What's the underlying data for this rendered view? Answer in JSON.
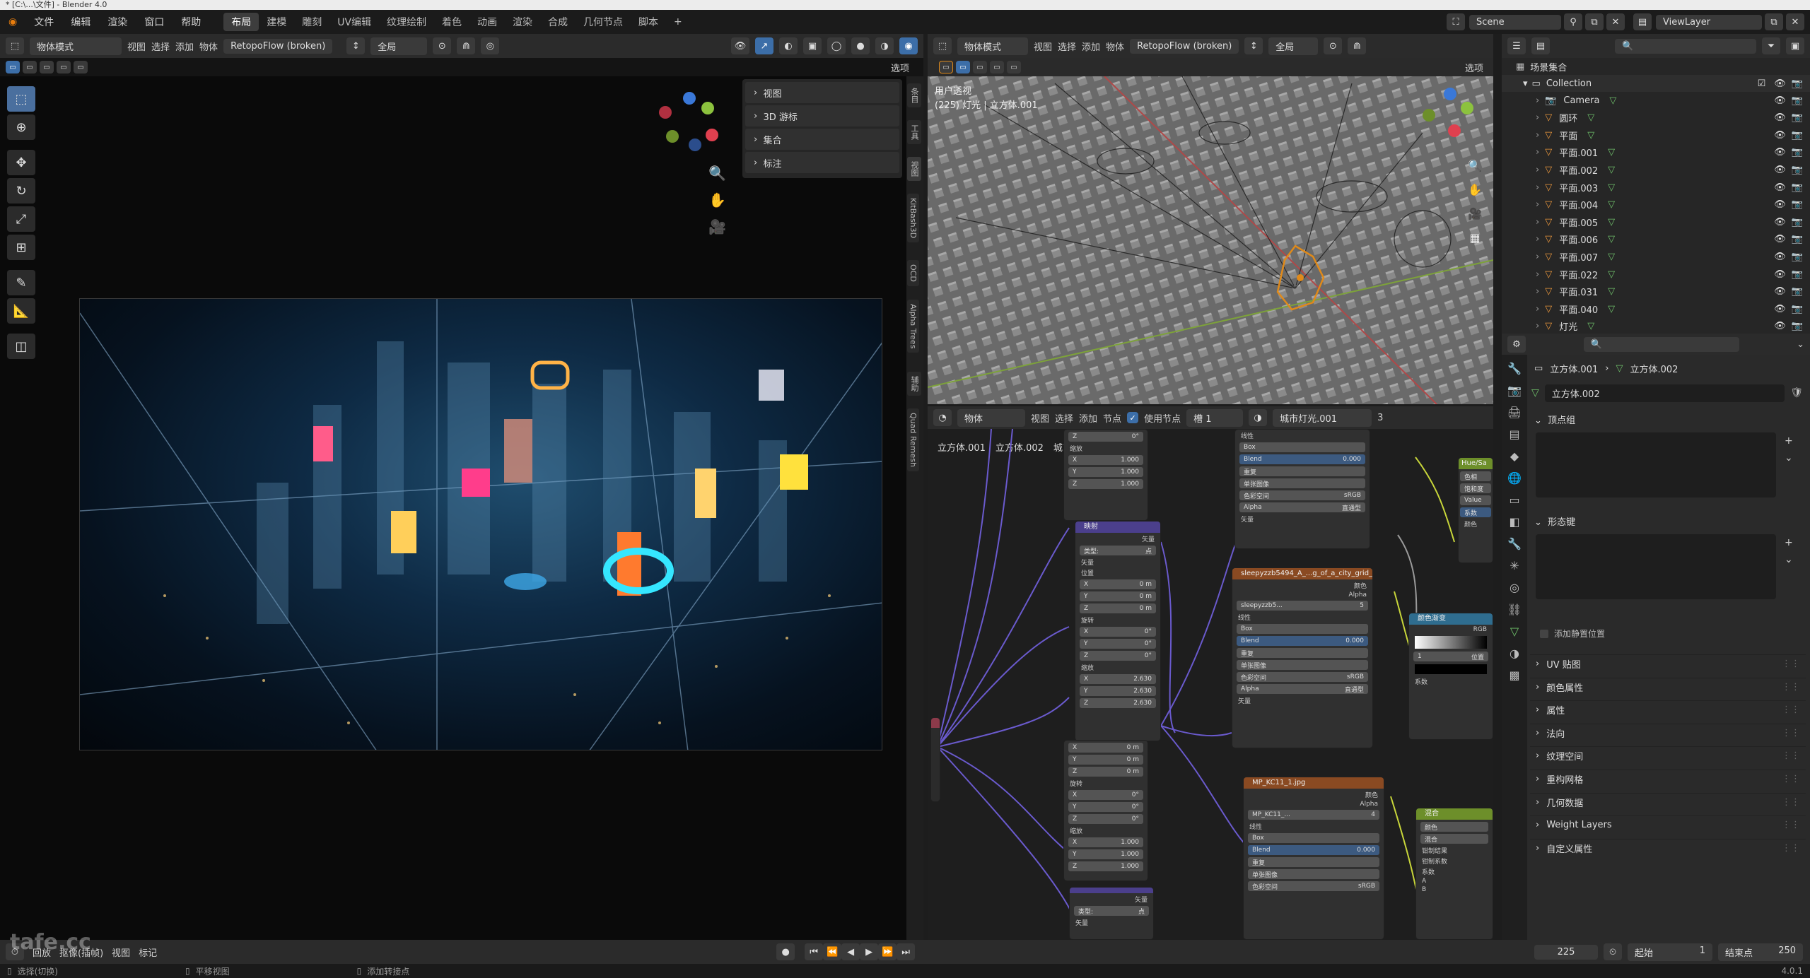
{
  "titlebar": {
    "text": "* [C:\\...\\文件] - Blender 4.0"
  },
  "menubar": {
    "menus": [
      "文件",
      "编辑",
      "渲染",
      "窗口",
      "帮助"
    ],
    "workspaces": [
      "布局",
      "建模",
      "雕刻",
      "UV编辑",
      "纹理绘制",
      "着色",
      "动画",
      "渲染",
      "合成",
      "几何节点",
      "脚本"
    ],
    "active_workspace": "布局",
    "add_tab": "+",
    "scene": "Scene",
    "view_layer": "ViewLayer"
  },
  "left_viewport": {
    "mode": "物体模式",
    "menu": [
      "视图",
      "选择",
      "添加",
      "物体"
    ],
    "addon": "RetopoFlow (broken)",
    "transform": "全局",
    "options": "选项",
    "npanel": [
      "视图",
      "3D 游标",
      "集合",
      "标注"
    ]
  },
  "side_tabs": [
    "条目",
    "工具",
    "视图",
    "KitBash3D",
    "OCD",
    "Alpha Trees",
    "辅助",
    "Quad Remesh"
  ],
  "right_viewport": {
    "mode": "物体模式",
    "menu": [
      "视图",
      "选择",
      "添加",
      "物体"
    ],
    "addon": "RetopoFlow (broken)",
    "transform": "全局",
    "options": "选项",
    "view_name": "用户透视",
    "view_sub": "(225) 灯光 | 立方体.001"
  },
  "node_editor": {
    "type": "物体",
    "menu": [
      "视图",
      "选择",
      "添加",
      "节点"
    ],
    "use_nodes": "使用节点",
    "slot": "槽 1",
    "material": "城市灯光.001",
    "users": "3",
    "breadcrumb": [
      "立方体.001",
      "立方体.002",
      "城市灯光.001"
    ],
    "nodes": {
      "mapping": {
        "title": "映射",
        "out": "矢量",
        "type_label": "类型:",
        "type": "点",
        "in": "矢量",
        "loc": "位置",
        "rot": "旋转",
        "scale": "缩放",
        "loc_vals": [
          "0 m",
          "0 m",
          "0 m"
        ],
        "rot_vals": [
          "0°",
          "0°",
          "0°"
        ],
        "scale_vals": [
          "2.630",
          "2.630",
          "2.630"
        ]
      },
      "img1": {
        "title": "sleepyzzb5494_A_...g_of_a_city_grid_on",
        "color": "颜色",
        "alpha": "Alpha",
        "name": "sleepyzzb5...",
        "count": "5",
        "interp": "线性",
        "proj": "Box",
        "blend": "Blend",
        "blend_val": "0.000",
        "ext": "重复",
        "src": "单张图像",
        "cs_label": "色彩空间",
        "cs": "sRGB",
        "alpha_label": "Alpha",
        "alpha_val": "直通型",
        "vec": "矢量"
      },
      "img0": {
        "interp": "线性",
        "proj": "Box",
        "blend": "Blend",
        "blend_val": "0.000",
        "ext": "重复",
        "src": "单张图像",
        "cs_label": "色彩空间",
        "cs": "sRGB",
        "alpha_label": "Alpha",
        "alpha_val": "直通型",
        "vec": "矢量"
      },
      "img2": {
        "title": "MP_KC11_1.jpg",
        "color": "颜色",
        "alpha": "Alpha",
        "name": "MP_KC11_...",
        "count": "4",
        "interp": "线性",
        "proj": "Box",
        "blend": "Blend",
        "blend_val": "0.000",
        "ext": "重复",
        "src": "单张图像",
        "cs_label": "色彩空间",
        "cs": "sRGB"
      },
      "ramp": {
        "title": "颜色渐变",
        "mode": "RGB",
        "pos": "1",
        "pos_label": "位置",
        "fac": "系数"
      },
      "hue": {
        "title": "Hue/Sa",
        "rows": [
          "色相",
          "饱和度",
          "Value",
          "系数",
          "颜色"
        ]
      },
      "mix": {
        "title": "混合",
        "rows": [
          "颜色",
          "混合",
          "钳制结果",
          "钳制系数",
          "系数",
          "A",
          "B"
        ]
      },
      "frame": {
        "rows": [
          "X",
          "Y",
          "Z"
        ],
        "vals": [
          "1.000",
          "1.000",
          "1.000"
        ]
      },
      "mapping2": {
        "loc_vals": [
          "0 m",
          "0 m",
          "0 m"
        ],
        "rot_vals": [
          "0°",
          "0°",
          "0°"
        ],
        "scale_vals": [
          "1.000",
          "1.000",
          "1.000"
        ]
      }
    }
  },
  "outliner": {
    "root": "场景集合",
    "collection": "Collection",
    "items": [
      "Camera",
      "圆环",
      "平面",
      "平面.001",
      "平面.002",
      "平面.003",
      "平面.004",
      "平面.005",
      "平面.006",
      "平面.007",
      "平面.022",
      "平面.031",
      "平面.040",
      "灯光"
    ]
  },
  "properties": {
    "crumb_a": "立方体.001",
    "crumb_b": "立方体.002",
    "mesh_name": "立方体.002",
    "sections": [
      "顶点组",
      "形态键"
    ],
    "relative_label": "添加静置位置",
    "collapsed": [
      "UV 贴图",
      "颜色属性",
      "属性",
      "法向",
      "纹理空间",
      "重构网格",
      "几何数据",
      "Weight Layers",
      "自定义属性"
    ]
  },
  "timeline": {
    "playback": "回放",
    "keying": "抠像(插帧)",
    "view": "视图",
    "marker": "标记",
    "current_frame": "225",
    "start_label": "起始",
    "start": "1",
    "end_label": "结束点",
    "end": "250"
  },
  "statusbar": {
    "select": "选择(切换)",
    "pan": "平移视图",
    "context": "添加转接点",
    "version": "4.0.1"
  },
  "watermark": "tafe.cc",
  "colors": {
    "accent": "#3c6ea8",
    "active_outline": "#e08a1a",
    "node_link": "#6a5acd"
  }
}
